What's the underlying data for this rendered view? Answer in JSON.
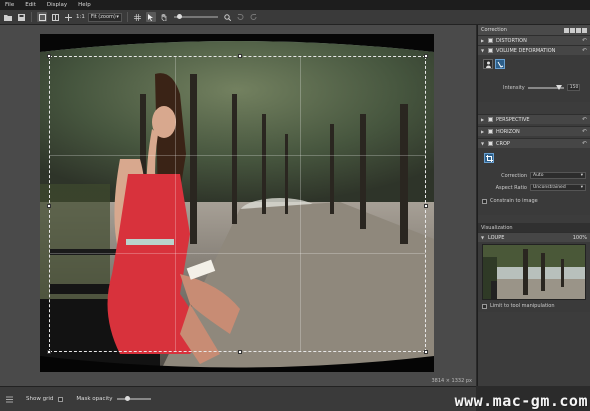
{
  "menu": [
    "File",
    "Edit",
    "Display",
    "Help"
  ],
  "toolbar": {
    "zoom_1to1": "1:1",
    "fit_label": "Fit (zoom)",
    "icons": [
      "open-folder-icon",
      "save-icon",
      "side-by-side-icon",
      "split-view-icon",
      "move-icon",
      "grid-icon",
      "select-arrow-icon",
      "hand-icon",
      "zoom-icon",
      "undo-icon",
      "redo-icon"
    ]
  },
  "canvas": {
    "dimensions": "3814 × 1332 px"
  },
  "statusbar": {
    "show_grid_label": "Show grid",
    "mask_opacity_label": "Mask opacity",
    "watermark": "www.mac-gm.com"
  },
  "panel": {
    "title": "Correction",
    "sections": {
      "distortion": "DISTORTION",
      "volume_deformation": "VOLUME DEFORMATION",
      "perspective": "PERSPECTIVE",
      "horizon": "HORIZON",
      "crop": "CROP"
    },
    "intensity_label": "Intensity",
    "intensity_value": "150",
    "correction_label": "Correction",
    "correction_value": "Auto",
    "aspect_ratio_label": "Aspect Ratio",
    "aspect_ratio_value": "Unconstrained",
    "constrain_label": "Constrain to image",
    "visualization_title": "Visualization",
    "visualization_zoom": "100%",
    "loupe_label": "LOUPE",
    "limit_label": "Limit to tool manipulation"
  },
  "colors": {
    "accent": "#2d5f8a",
    "panel_bg": "#3c3c3c",
    "canvas_bg": "#4a4a4a"
  }
}
